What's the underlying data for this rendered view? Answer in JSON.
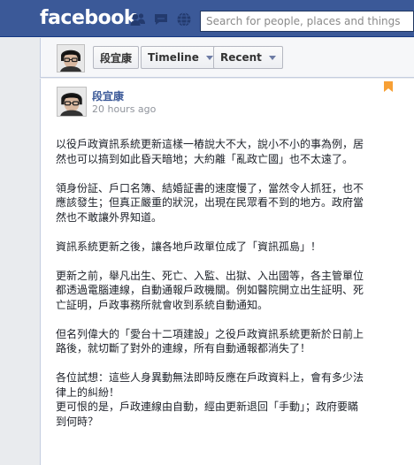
{
  "header": {
    "logo": "facebook",
    "search_placeholder": "Search for people, places and things",
    "jewels": [
      "friend-requests-icon",
      "messages-icon",
      "notifications-icon"
    ]
  },
  "timeline_nav": {
    "name": "段宜康",
    "timeline_label": "Timeline",
    "recent_label": "Recent"
  },
  "post": {
    "author": "段宜康",
    "timestamp": "20 hours ago",
    "paragraphs": [
      "以役戶政資訊系統更新這樣一樁說大不大，說小不小的事為例，居\n然也可以搞到如此昏天暗地；大約離「亂政亡國」也不太遠了。",
      "領身份証、戶口名簿、結婚証書的速度慢了，當然令人抓狂，也不\n應該發生；但真正嚴重的狀況，出現在民眾看不到的地方。政府當\n然也不敢讓外界知道。",
      "資訊系統更新之後，讓各地戶政單位成了「資訊孤島」！",
      "更新之前，舉凡出生、死亡、入監、出獄、入出國等，各主管單位\n都透過電腦連線，自動通報戶政機關。例如醫院開立出生証明、死\n亡証明，戶政事務所就會收到系統自動通知。",
      "但名列偉大的「愛台十二項建設」之役戶政資訊系統更新於日前上\n路後，就切斷了對外的連線，所有自動通報都消失了！",
      "各位試想：這些人身異動無法即時反應在戶政資料上，會有多少法\n律上的糾紛！\n更可恨的是，戶政連線由自動，經由更新退回「手動」；政府要瞞\n到何時？"
    ]
  },
  "colors": {
    "brand": "#3b5998",
    "bookmark": "#f7a035"
  }
}
